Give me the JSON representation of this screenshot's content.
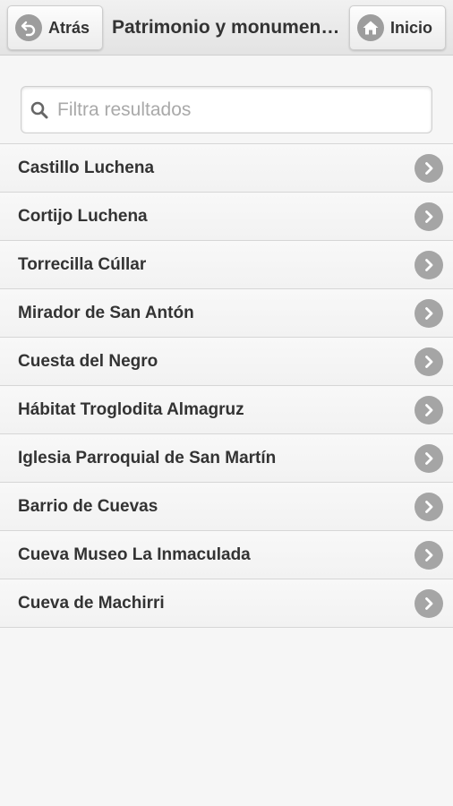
{
  "header": {
    "back_label": "Atrás",
    "title": "Patrimonio y monumentos",
    "home_label": "Inicio"
  },
  "search": {
    "placeholder": "Filtra resultados",
    "value": ""
  },
  "list": {
    "items": [
      {
        "label": "Castillo Luchena"
      },
      {
        "label": "Cortijo Luchena"
      },
      {
        "label": "Torrecilla Cúllar"
      },
      {
        "label": "Mirador de San Antón"
      },
      {
        "label": "Cuesta del Negro"
      },
      {
        "label": "Hábitat Troglodita Almagruz"
      },
      {
        "label": "Iglesia Parroquial de San Martín"
      },
      {
        "label": "Barrio de Cuevas"
      },
      {
        "label": "Cueva Museo La Inmaculada"
      },
      {
        "label": "Cueva de Machirri"
      }
    ]
  },
  "icons": {
    "back": "back-arrow-icon",
    "home": "home-icon",
    "search": "search-icon",
    "item": "chevron-right-icon"
  },
  "colors": {
    "icon_bg": "#9d9d9d",
    "text": "#333333",
    "background": "#f6f6f6"
  }
}
